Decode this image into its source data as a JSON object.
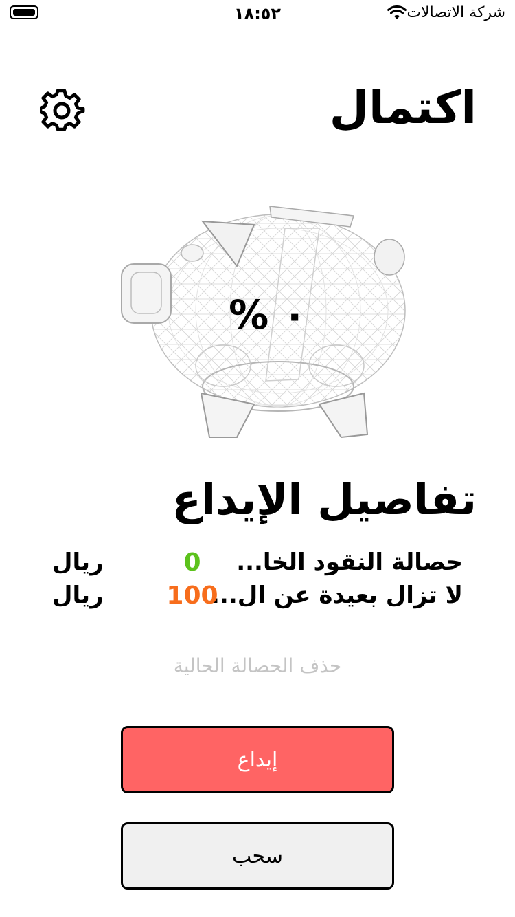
{
  "status_bar": {
    "time": "١٨:٥٢",
    "carrier": "شركة الاتصالات",
    "icons": [
      "battery-icon",
      "wifi-icon"
    ]
  },
  "header": {
    "title": "اكتمال",
    "settings_icon": "gear-icon"
  },
  "progress": {
    "percent_text": "٠ %",
    "value": 0
  },
  "details": {
    "title": "تفاصيل الإيداع",
    "rows": [
      {
        "label": "حصالة النقود الخا...",
        "amount": "0",
        "currency": "ريال",
        "color": "#5cc21c"
      },
      {
        "label": "لا تزال بعيدة عن ال...",
        "amount": "100",
        "currency": "ريال",
        "color": "#f76d1c"
      }
    ]
  },
  "actions": {
    "delete_label": "حذف الحصالة الحالية",
    "deposit_label": "إيداع",
    "withdraw_label": "سحب"
  },
  "colors": {
    "deposit_button": "#ff6464",
    "withdraw_button": "#f0f0f0",
    "delete_text": "#c4c4c4"
  }
}
